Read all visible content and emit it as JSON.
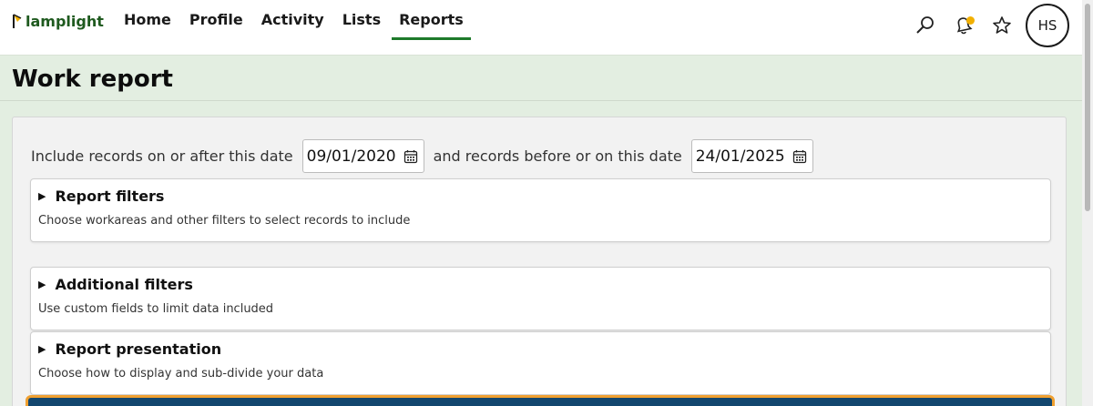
{
  "app": {
    "logo_text": "lamplight"
  },
  "nav": {
    "items": [
      "Home",
      "Profile",
      "Activity",
      "Lists",
      "Reports"
    ],
    "active": "Reports"
  },
  "user": {
    "initials": "HS"
  },
  "page": {
    "title": "Work report"
  },
  "date_range": {
    "after_label": "Include records on or after this date",
    "after_value": "09/01/2020",
    "before_label": "and records before or on this date",
    "before_value": "24/01/2025"
  },
  "sections": [
    {
      "title": "Report filters",
      "description": "Choose workareas and other filters to select records to include"
    },
    {
      "title": "Additional filters",
      "description": "Use custom fields to limit data included"
    },
    {
      "title": "Report presentation",
      "description": "Choose how to display and sub-divide your data"
    }
  ],
  "colors": {
    "brand_green": "#1e7a2a",
    "accent_dot": "#f2b000",
    "button_blue": "#12466e",
    "focus_orange": "#f0a030"
  }
}
